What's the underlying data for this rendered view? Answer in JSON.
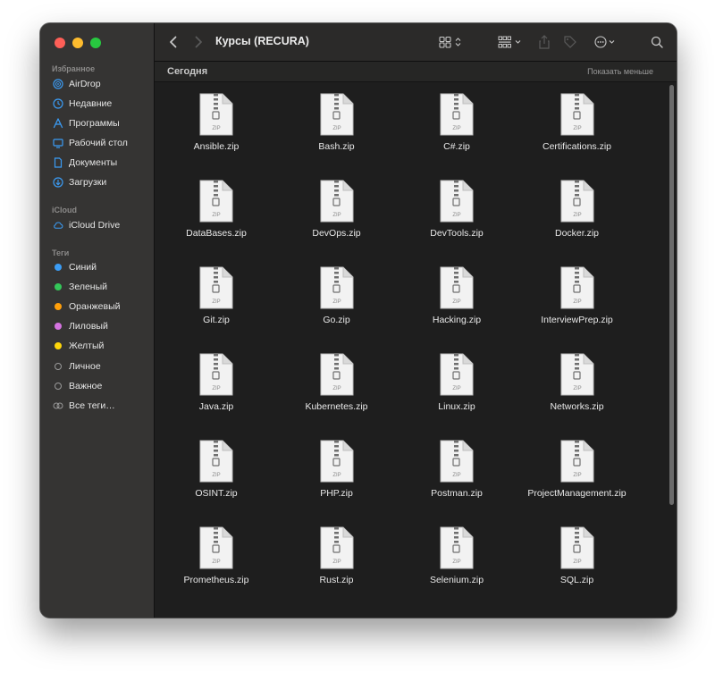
{
  "window": {
    "title": "Курсы (RECURA)"
  },
  "sidebar": {
    "sections": [
      {
        "label": "Избранное",
        "items": [
          {
            "label": "AirDrop",
            "icon": "airdrop-icon"
          },
          {
            "label": "Недавние",
            "icon": "clock-icon"
          },
          {
            "label": "Программы",
            "icon": "apps-icon"
          },
          {
            "label": "Рабочий стол",
            "icon": "desktop-icon"
          },
          {
            "label": "Документы",
            "icon": "document-icon"
          },
          {
            "label": "Загрузки",
            "icon": "download-icon"
          }
        ]
      },
      {
        "label": "iCloud",
        "items": [
          {
            "label": "iCloud Drive",
            "icon": "cloud-icon"
          }
        ]
      },
      {
        "label": "Теги",
        "items": [
          {
            "label": "Синий",
            "color": "#3b9cf5"
          },
          {
            "label": "Зеленый",
            "color": "#34c759"
          },
          {
            "label": "Оранжевый",
            "color": "#ff9f0a"
          },
          {
            "label": "Лиловый",
            "color": "#d573e0"
          },
          {
            "label": "Желтый",
            "color": "#ffd60a"
          },
          {
            "label": "Личное",
            "color": ""
          },
          {
            "label": "Важное",
            "color": ""
          },
          {
            "label": "Все теги…",
            "icon": "all-tags-icon"
          }
        ]
      }
    ]
  },
  "toolbar": {
    "back_icon": "chevron-left-icon",
    "forward_icon": "chevron-right-icon",
    "view_icon": "icon-grid-view-icon",
    "group_icon": "group-by-icon",
    "share_icon": "share-icon",
    "tag_icon": "tag-icon",
    "more_icon": "ellipsis-circle-icon",
    "search_icon": "search-icon"
  },
  "content": {
    "group_title": "Сегодня",
    "show_less": "Показать меньше",
    "files": [
      "Ansible.zip",
      "Bash.zip",
      "C#.zip",
      "Certifications.zip",
      "DataBases.zip",
      "DevOps.zip",
      "DevTools.zip",
      "Docker.zip",
      "Git.zip",
      "Go.zip",
      "Hacking.zip",
      "InterviewPrep.zip",
      "Java.zip",
      "Kubernetes.zip",
      "Linux.zip",
      "Networks.zip",
      "OSINT.zip",
      "PHP.zip",
      "Postman.zip",
      "ProjectManagement.zip",
      "Prometheus.zip",
      "Rust.zip",
      "Selenium.zip",
      "SQL.zip"
    ],
    "zip_label": "ZIP"
  },
  "colors": {
    "sidebar_bg": "#353433",
    "content_bg": "#1e1e1e",
    "accent": "#3b9cf5"
  }
}
